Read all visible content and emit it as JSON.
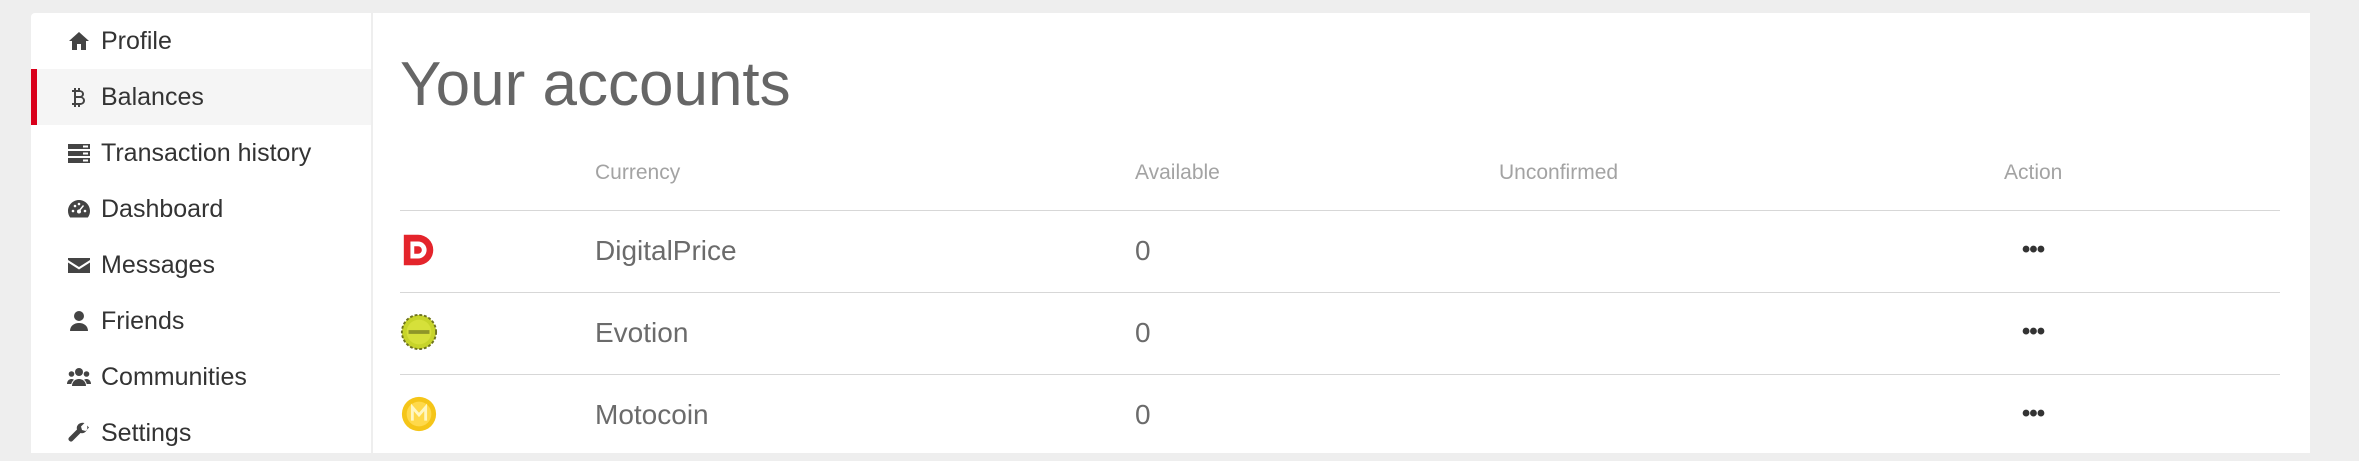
{
  "sidebar": {
    "items": [
      {
        "label": "Profile",
        "icon": "home-icon"
      },
      {
        "label": "Balances",
        "icon": "bitcoin-icon",
        "active": true
      },
      {
        "label": "Transaction history",
        "icon": "server-icon"
      },
      {
        "label": "Dashboard",
        "icon": "dashboard-icon"
      },
      {
        "label": "Messages",
        "icon": "envelope-icon"
      },
      {
        "label": "Friends",
        "icon": "user-icon"
      },
      {
        "label": "Communities",
        "icon": "users-icon"
      },
      {
        "label": "Settings",
        "icon": "wrench-icon"
      }
    ],
    "accent_color": "#d9001b"
  },
  "main": {
    "title": "Your accounts",
    "table": {
      "headers": {
        "currency": "Currency",
        "available": "Available",
        "unconfirmed": "Unconfirmed",
        "action": "Action"
      },
      "rows": [
        {
          "currency": "DigitalPrice",
          "available": "0",
          "unconfirmed": "",
          "action": "•••",
          "icon": "digitalprice-logo-icon"
        },
        {
          "currency": "Evotion",
          "available": "0",
          "unconfirmed": "",
          "action": "•••",
          "icon": "evotion-logo-icon"
        },
        {
          "currency": "Motocoin",
          "available": "0",
          "unconfirmed": "",
          "action": "•••",
          "icon": "motocoin-logo-icon"
        }
      ]
    }
  }
}
